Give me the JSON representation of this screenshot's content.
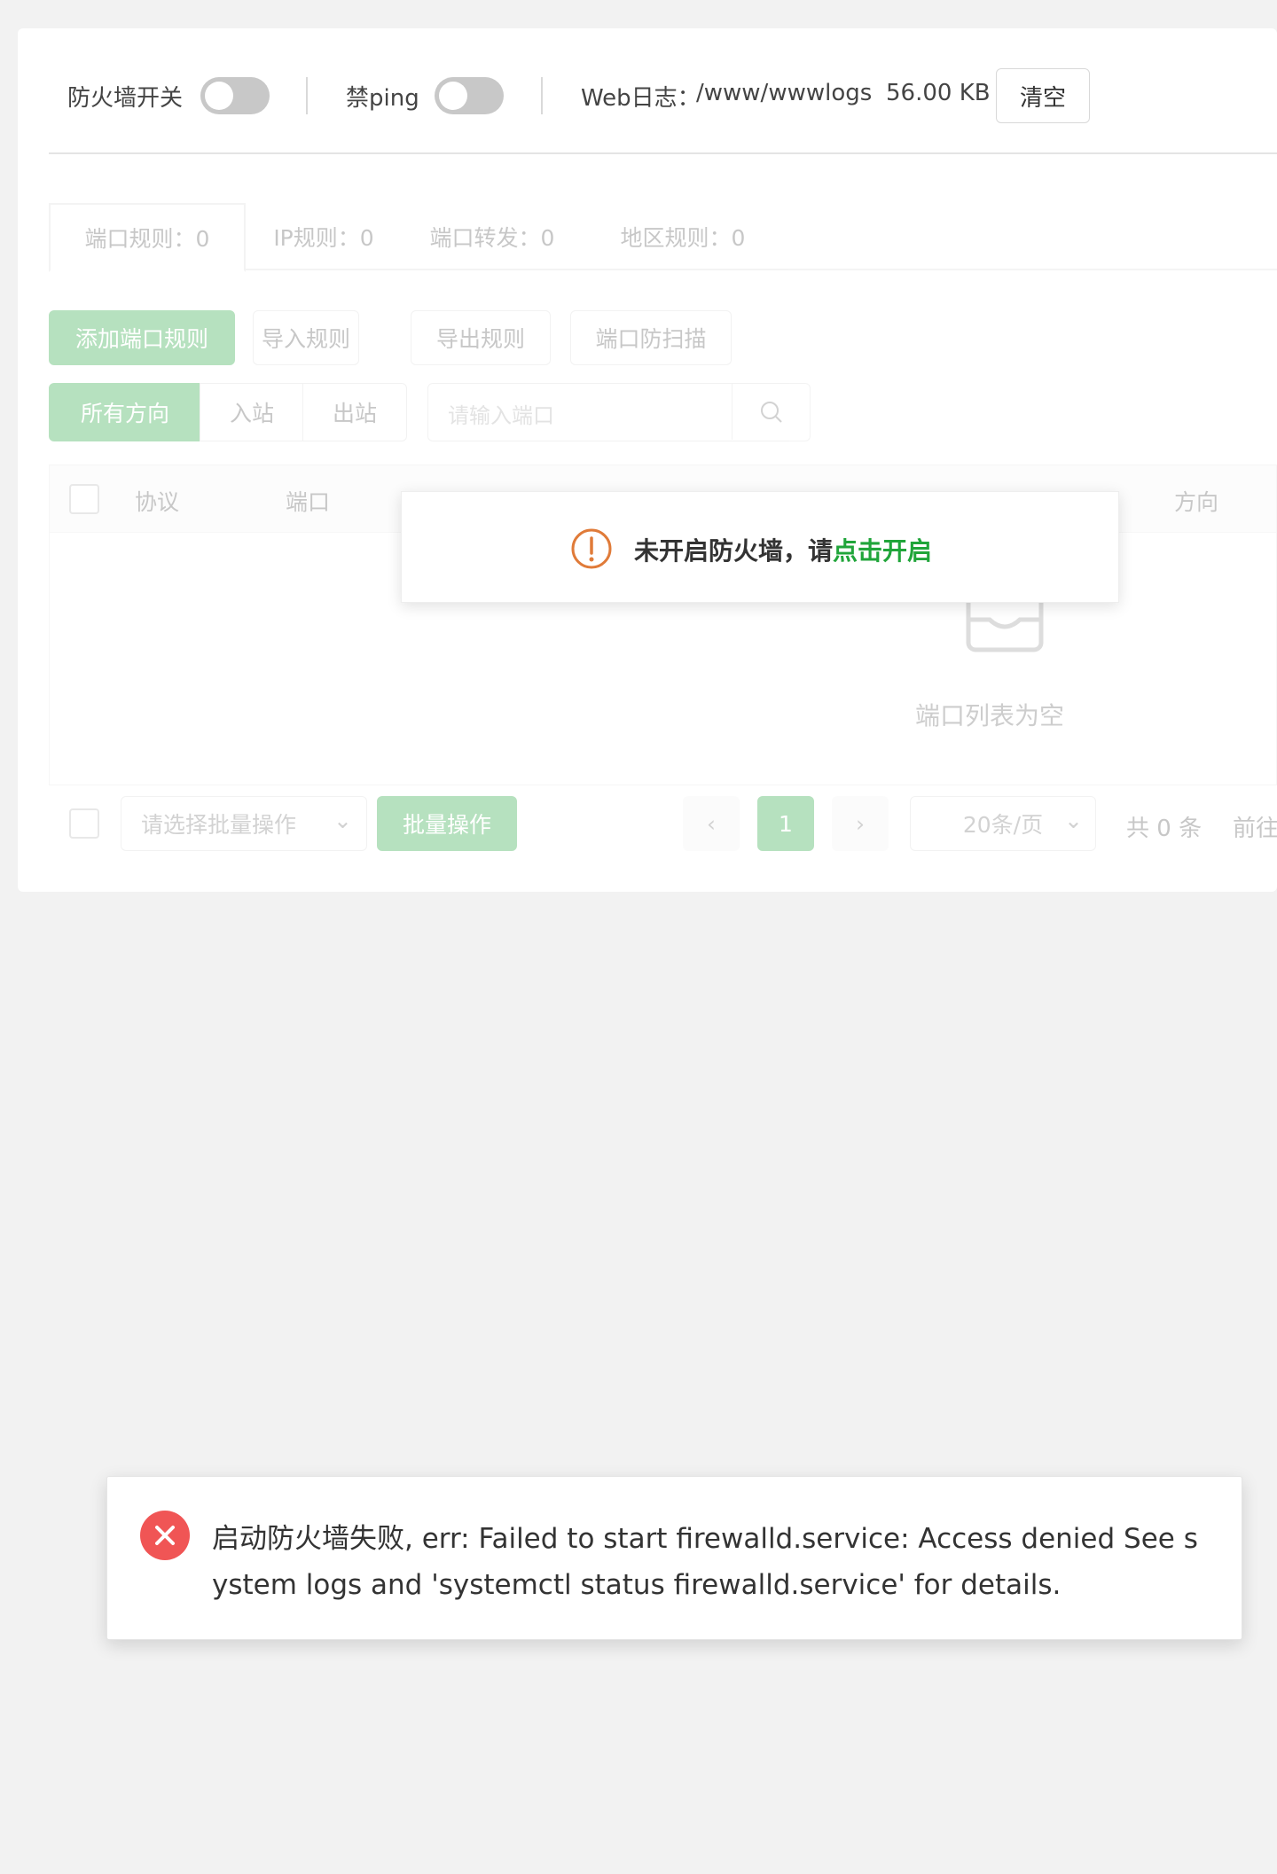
{
  "topbar": {
    "firewall_label": "防火墙开关",
    "ping_label": "禁ping",
    "weblog_label": "Web日志：",
    "weblog_path": "/www/wwwlogs",
    "weblog_size": "56.00 KB",
    "clear_button": "清空"
  },
  "tabs": [
    {
      "label": "端口规则：0"
    },
    {
      "label": "IP规则：0"
    },
    {
      "label": "端口转发：0"
    },
    {
      "label": "地区规则：0"
    }
  ],
  "actions": {
    "add_rule": "添加端口规则",
    "import_rules": "导入规则",
    "export_rules": "导出规则",
    "port_scan_protect": "端口防扫描"
  },
  "filters": {
    "all_directions": "所有方向",
    "inbound": "入站",
    "outbound": "出站",
    "search_placeholder": "请输入端口"
  },
  "table": {
    "headers": {
      "protocol": "协议",
      "port": "端口",
      "direction": "方向"
    },
    "empty_text": "端口列表为空"
  },
  "footer": {
    "batch_select_placeholder": "请选择批量操作",
    "batch_button": "批量操作",
    "current_page": "1",
    "page_size": "20条/页",
    "total": "共 0 条",
    "goto": "前往"
  },
  "notice": {
    "message": "未开启防火墙，请",
    "link": "点击开启"
  },
  "toast": {
    "message": "启动防火墙失败, err: Failed to start firewalld.service: Access denied See system logs and 'systemctl status firewalld.service' for details."
  },
  "colors": {
    "accent": "#20a53a",
    "warning": "#e07b39",
    "error": "#f05555"
  }
}
